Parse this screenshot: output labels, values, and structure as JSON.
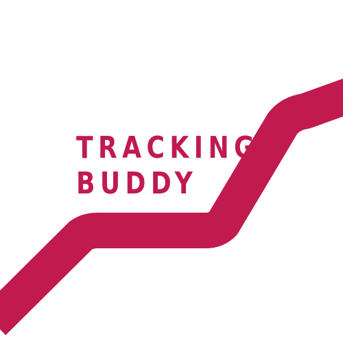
{
  "logo": {
    "line1": "TRACKING",
    "line2": "BUDDY",
    "accent_color": "#c01a4e",
    "background_color": "#ffffff"
  }
}
